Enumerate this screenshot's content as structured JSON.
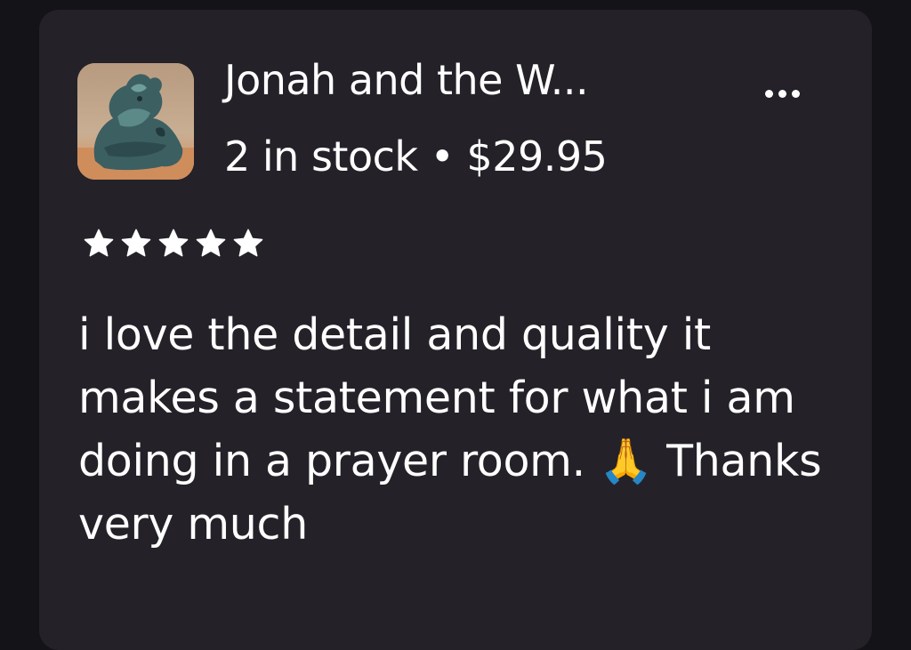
{
  "product": {
    "title": "Jonah and the W...",
    "stock_text": "2 in stock",
    "separator": "•",
    "price": "$29.95",
    "image_icon": "whale-sculpture-photo"
  },
  "menu": {
    "icon": "more-horizontal-icon"
  },
  "rating": {
    "value": 5,
    "max": 5,
    "color": "#ffffff"
  },
  "review": {
    "text": "i love the detail and quality it makes a statement for what i am doing in a prayer room. 🙏 Thanks very much"
  },
  "colors": {
    "background": "#141317",
    "card": "#242228",
    "text": "#ffffff"
  }
}
